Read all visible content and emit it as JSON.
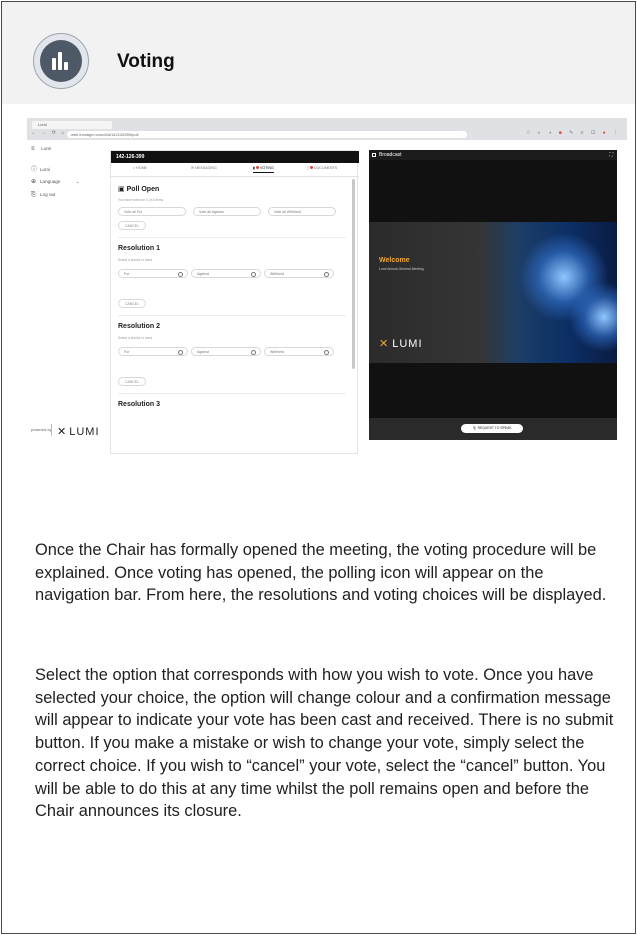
{
  "header": {
    "title": "Voting"
  },
  "screenshot": {
    "browser": {
      "tab_label": "Lumi",
      "url": "web.lumiagm.com/#/a/142126399/poll"
    },
    "sidebar": {
      "meeting_label": "Lumi",
      "items": [
        {
          "label": "Lumi",
          "icon": "info-icon"
        },
        {
          "label": "Language",
          "icon": "globe-icon"
        },
        {
          "label": "Log out",
          "icon": "logout-icon"
        }
      ],
      "powered_by": "powered by",
      "logo_text": "LUMI"
    },
    "main": {
      "meeting_id": "142-126-399",
      "tabs": [
        "HOME",
        "MESSAGING",
        "VOTING",
        "DOCUMENTS"
      ],
      "poll_title": "Poll Open",
      "poll_sub": "You have voted on 0 of 3 items",
      "vote_all": [
        "Vote all For",
        "Vote all Against",
        "Vote all Withheld"
      ],
      "cancel_label": "CANCEL",
      "select_hint": "Select a choice to send.",
      "choices": [
        "For",
        "Against",
        "Withheld"
      ],
      "resolutions": [
        "Resolution 1",
        "Resolution 2",
        "Resolution 3"
      ]
    },
    "broadcast": {
      "title": "Broadcast",
      "welcome": "Welcome",
      "welcome_sub": "Lumi Annual General Meeting",
      "logo_text": "LUMI",
      "request_to_speak": "REQUEST TO SPEAK"
    }
  },
  "body": {
    "paragraph1": "Once the Chair has formally opened the meeting, the voting procedure will be explained. Once voting has opened, the polling icon will appear on the navigation bar. From here, the resolutions and voting choices will be displayed.",
    "paragraph2": "Select the option that corresponds with how you wish to vote. Once you have selected your choice, the option will change colour and a confirmation message will appear to indicate your vote has been cast and received. There is no submit button. If you make a mistake or wish to change your vote, simply select the correct choice. If you wish to “cancel” your vote, select the “cancel” button. You will be able to do this at any time whilst the poll remains open and before the Chair announces its closure."
  },
  "colors": {
    "accent_orange": "#f0a82a",
    "badge_bg": "#4d5966",
    "alert_red": "#e2453a"
  }
}
